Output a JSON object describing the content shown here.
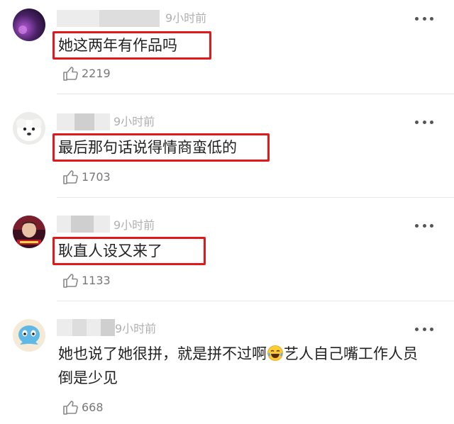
{
  "comments": [
    {
      "time": "9小时前",
      "text": "她这两年有作品吗",
      "likes": "2219",
      "avatar": "dark-purple-avatar",
      "highlighted": true
    },
    {
      "time": "9小时前",
      "text": "最后那句话说得情商蛮低的",
      "likes": "1703",
      "avatar": "white-dog-avatar",
      "highlighted": true
    },
    {
      "time": "9小时前",
      "text": "耿直人设又来了",
      "likes": "1133",
      "avatar": "red-poster-avatar",
      "highlighted": true
    },
    {
      "time": "9小时前",
      "text_part1": "她也说了她很拼，就是拼不过啊",
      "emoji": "tears-of-joy-emoji",
      "text_part2": "艺人自己嘴工作人员倒是少见",
      "likes": "668",
      "avatar": "blue-cartoon-avatar",
      "highlighted": false
    }
  ],
  "colors": {
    "highlight": "#e01a1a",
    "time": "#b0b0b0",
    "text": "#222222",
    "likes": "#777777"
  }
}
